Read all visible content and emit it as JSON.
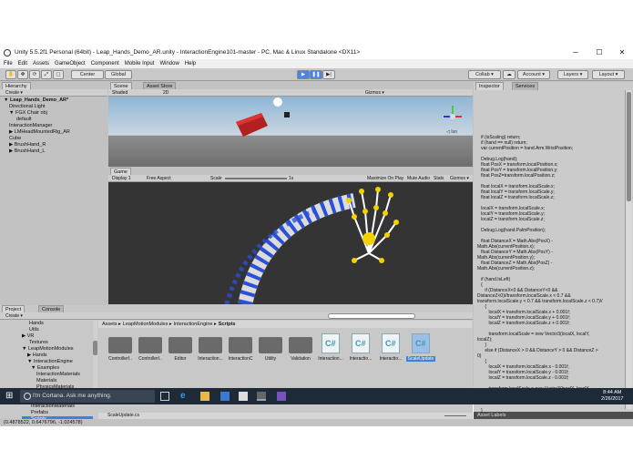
{
  "window": {
    "title": "Unity 5.5.2f1 Personal (64bit) - Leap_Hands_Demo_AR.unity - InteractionEngine101-master - PC, Mac & Linux Standalone <DX11>",
    "minimize": "─",
    "maximize": "☐",
    "close": "✕"
  },
  "menu": [
    "File",
    "Edit",
    "Assets",
    "GameObject",
    "Component",
    "Mobile Input",
    "Window",
    "Help"
  ],
  "toolbar": {
    "center": "Center",
    "global": "Global",
    "collab": "Collab ▾",
    "account": "Account ▾",
    "layers": "Layers ▾",
    "layout": "Layout ▾"
  },
  "hierarchy": {
    "tab": "Hierarchy",
    "create": "Create ▾",
    "items": [
      "▼ Leap_Hands_Demo_AR*",
      "Directional Light",
      "▼ FGX Chair obj",
      "default",
      "InteractionManager",
      "▶ LMHeadMountedRig_AR",
      "Cube",
      "▶ BrushHand_R",
      "▶ BrushHand_L"
    ]
  },
  "scene": {
    "tab_scene": "Scene",
    "tab_asset_store": "Asset Store",
    "shaded": "Shaded",
    "mode2d": "2D",
    "gizmos": "Gizmos ▾",
    "persp": "◁ Iso"
  },
  "game": {
    "tab": "Game",
    "display": "Display 1",
    "aspect": "Free Aspect",
    "scale_label": "Scale",
    "scale_value": "1x",
    "maximize": "Maximize On Play",
    "mute": "Mute Audio",
    "stats": "Stats",
    "gizmos": "Gizmos ▾"
  },
  "project": {
    "tab_project": "Project",
    "tab_console": "Console",
    "create": "Create ▾",
    "breadcrumb": [
      "Assets",
      "LeapMotionModules",
      "InteractionEngine",
      "Scripts"
    ],
    "tree": [
      "Hands",
      "Utils",
      "▶ VR",
      "Textures",
      "▼ LeapMotionModules",
      "▶ Hands",
      "▼ InteractionEngine",
      "▼ Examples",
      "InteractionMaterials",
      "Materials",
      "PhysicsMaterials",
      "Prefabs",
      "Scenes",
      "InteractionMaterials",
      "Prefabs",
      "Scripts"
    ],
    "assets": [
      "ControllerI..",
      "ControllerI..",
      "Editor",
      "Interaction...",
      "InteractionC",
      "Utility",
      "Validation",
      "Interaction...",
      "Interactio...",
      "Interactio...",
      "ScaleUpdate"
    ],
    "selected_file": "ScaleUpdate.cs",
    "status": "(0.4878522, 0.6476796, -1.024578)"
  },
  "inspector": {
    "tab_inspector": "Inspector",
    "tab_services": "Services",
    "asset_labels": "Asset Labels",
    "code": "   if (isScaling) return;\n   if (hand == null) return;\n   var currentPosition = hand.Arm.WristPosition;\n\n   Debug.Log(hand);\n   float PosX = transform.localPosition.x;\n   float PosY = transform.localPosition.y;\n   float PosZ=transform.localPosition.z;\n\n   float localX = transform.localScale.x;\n   float localY = transform.localScale.y;\n   float localZ = transform.localScale.z;\n\n   localX = transform.localScale.x;\n   localY = transform.localScale.y;\n   localZ = transform.localScale.z;\n\n   Debug.Log(hand.PalmPosition);\n\n   float DistanceX = Math.Abs(PosX) -\nMath.Abs(currentPosition.x);\n   float DistanceY = Math.Abs(PosY) -\nMath.Abs(currentPosition.y);\n   float DistanceZ = Math.Abs(PosZ) -\nMath.Abs(currentPosition.z);\n\n   if (hand.IsLeft)\n   {\n      if (DistanceX<0 && DistanceY<0 &&\nDistanceZ<0)//transform.localScale.x < 0.7 &&\ntransform.localScale.y < 0.7 && transform.localScale.z < 0.7)//\n      {\n         localX = transform.localScale.x + 0.001f;\n         localY = transform.localScale.y + 0.001f;\n         localZ = transform.localScale.z + 0.001f;\n\n         transform.localScale = new Vector3(localX, localY,\nlocalZ);\n      }\n      else if (DistanceX > 0 && DistanceY > 0 && DistanceZ >\n0)\n      {\n         localX = transform.localScale.x - 0.001f;\n         localY = transform.localScale.y - 0.001f;\n         localZ = transform.localScale.z - 0.001f;\n\n         transform.localScale = new Vector3(localX, localY,\nlocalZ);\n      }\n\n   }"
  },
  "taskbar": {
    "search_placeholder": "I'm Cortana. Ask me anything.",
    "time": "8:44 AM",
    "date": "2/26/2017"
  }
}
